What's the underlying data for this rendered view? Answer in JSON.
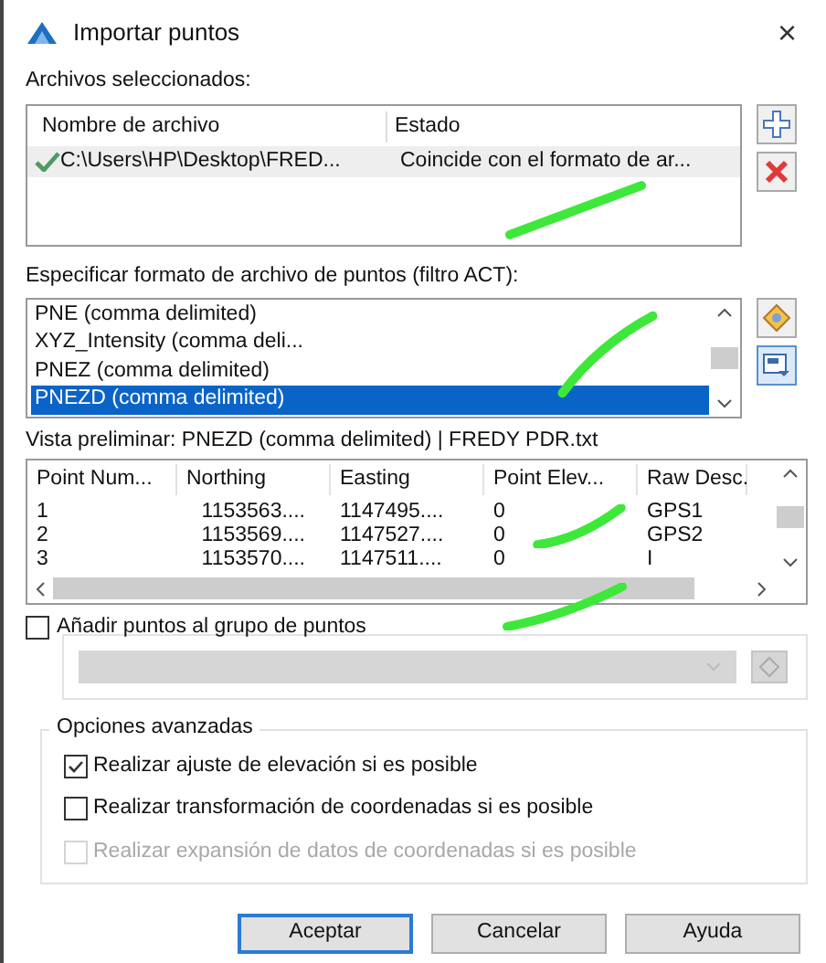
{
  "window": {
    "title": "Importar puntos",
    "close": "×"
  },
  "files": {
    "label": "Archivos seleccionados:",
    "columns": [
      "Nombre de archivo",
      "Estado"
    ],
    "rows": [
      {
        "name": "C:\\Users\\HP\\Desktop\\FRED...",
        "status": "Coincide con el formato de ar...",
        "ok": true
      }
    ]
  },
  "formats": {
    "label": "Especificar formato de archivo de puntos (filtro ACT):",
    "items": [
      {
        "label": "PNE (comma delimited)",
        "selected": false
      },
      {
        "label": "XYZ_Intensity (comma deli...",
        "selected": false
      },
      {
        "label": "PNEZ (comma delimited)",
        "selected": false
      },
      {
        "label": "PNEZD (comma delimited)",
        "selected": true
      }
    ]
  },
  "preview": {
    "label": "Vista preliminar: PNEZD (comma delimited) | FREDY PDR.txt",
    "columns": [
      "Point Num...",
      "Northing",
      "Easting",
      "Point Elev...",
      "Raw Desc."
    ],
    "rows": [
      [
        "1",
        "1153563....",
        "1147495....",
        "0",
        "GPS1"
      ],
      [
        "2",
        "1153569....",
        "1147527....",
        "0",
        "GPS2"
      ],
      [
        "3",
        "1153570....",
        "1147511....",
        "0",
        "I"
      ]
    ]
  },
  "group": {
    "label": "Añadir puntos al grupo de puntos",
    "checked": false
  },
  "advanced": {
    "label": "Opciones avanzadas",
    "options": [
      {
        "label": "Realizar ajuste de elevación si es posible",
        "checked": true,
        "disabled": false
      },
      {
        "label": "Realizar transformación de coordenadas si es posible",
        "checked": false,
        "disabled": false
      },
      {
        "label": "Realizar expansión de datos de coordenadas si es posible",
        "checked": false,
        "disabled": true
      }
    ]
  },
  "buttons": [
    {
      "label": "Aceptar",
      "default": true
    },
    {
      "label": "Cancelar",
      "default": false
    },
    {
      "label": "Ayuda",
      "default": false
    }
  ]
}
